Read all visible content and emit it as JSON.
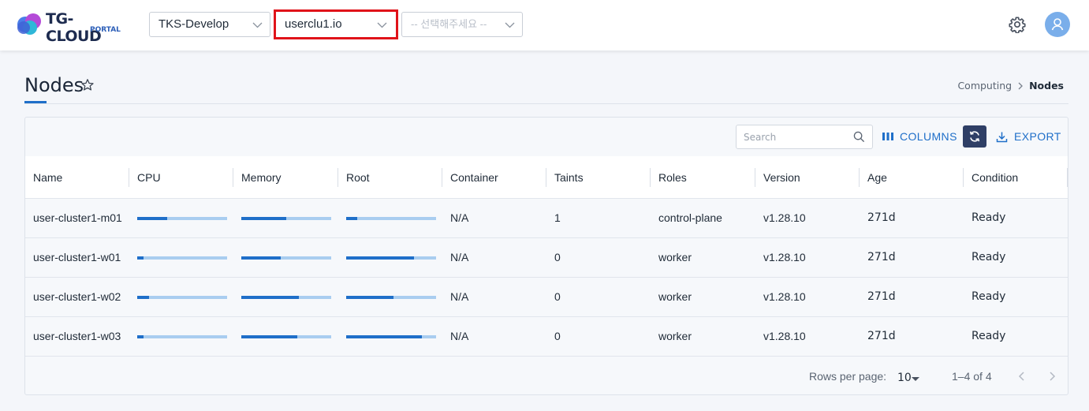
{
  "header": {
    "logo_text": "TG-CLOUD",
    "logo_sub": "PORTAL",
    "org_select": "TKS-Develop",
    "cluster_select": "userclu1.io",
    "namespace_select_placeholder": "-- 선택해주세요 --"
  },
  "page": {
    "title": "Nodes",
    "breadcrumb": [
      "Computing",
      "Nodes"
    ]
  },
  "toolbar": {
    "search_placeholder": "Search",
    "columns_label": "COLUMNS",
    "export_label": "EXPORT"
  },
  "table": {
    "columns": [
      "Name",
      "CPU",
      "Memory",
      "Root",
      "Container",
      "Taints",
      "Roles",
      "Version",
      "Age",
      "Condition"
    ],
    "rows": [
      {
        "name": "user-cluster1-m01",
        "cpu": 0.33,
        "memory": 0.5,
        "root": 0.12,
        "container": "N/A",
        "taints": "1",
        "roles": "control-plane",
        "version": "v1.28.10",
        "age": "271d",
        "condition": "Ready"
      },
      {
        "name": "user-cluster1-w01",
        "cpu": 0.07,
        "memory": 0.44,
        "root": 0.75,
        "container": "N/A",
        "taints": "0",
        "roles": "worker",
        "version": "v1.28.10",
        "age": "271d",
        "condition": "Ready"
      },
      {
        "name": "user-cluster1-w02",
        "cpu": 0.13,
        "memory": 0.64,
        "root": 0.53,
        "container": "N/A",
        "taints": "0",
        "roles": "worker",
        "version": "v1.28.10",
        "age": "271d",
        "condition": "Ready"
      },
      {
        "name": "user-cluster1-w03",
        "cpu": 0.07,
        "memory": 0.62,
        "root": 0.84,
        "container": "N/A",
        "taints": "0",
        "roles": "worker",
        "version": "v1.28.10",
        "age": "271d",
        "condition": "Ready"
      }
    ]
  },
  "pagination": {
    "rows_per_page_label": "Rows per page:",
    "rows_per_page_value": "10",
    "range_text": "1–4 of 4"
  },
  "colors": {
    "accent": "#1f6fc9",
    "highlight_border": "#e0131a",
    "refresh_bg": "#2f3f66"
  }
}
